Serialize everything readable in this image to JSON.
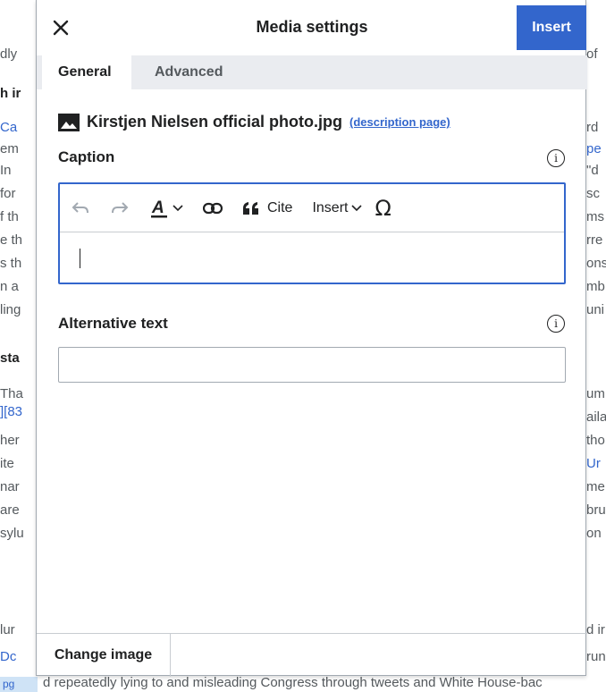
{
  "background": {
    "left": [
      "dly",
      "h ir",
      "Ca",
      "em",
      "In",
      "for",
      "f th",
      "e th",
      "s th",
      "n a",
      "ling",
      "sta",
      "Tha",
      "][83",
      "her",
      "ite",
      "nar",
      "are",
      "sylu",
      "lur",
      "Dc"
    ],
    "right": [
      "of",
      "rd",
      "pe",
      "\"d",
      "sc",
      "ms",
      "rre",
      "ons",
      "mb",
      "uni",
      "um",
      "aila",
      "tho",
      "Ur",
      "me",
      "bru",
      "on",
      "d ir",
      "run"
    ],
    "bottom_text": "d repeatedly lying to and misleading Congress through tweets and White House-bac",
    "bottom_tag": "pg"
  },
  "dialog": {
    "title": "Media settings",
    "insert_label": "Insert",
    "tabs": [
      {
        "label": "General",
        "active": true
      },
      {
        "label": "Advanced",
        "active": false
      }
    ],
    "file": {
      "name": "Kirstjen Nielsen official photo.jpg",
      "desc_link": "(description page)",
      "icon": "image-icon"
    },
    "caption": {
      "label": "Caption",
      "toolbar": {
        "undo_icon": "undo-icon",
        "redo_icon": "redo-icon",
        "style_icon": "text-style-icon",
        "link_icon": "link-icon",
        "cite_label": "Cite",
        "insert_label": "Insert",
        "special_char": "Ω"
      },
      "value": ""
    },
    "alt_text": {
      "label": "Alternative text",
      "value": "",
      "placeholder": ""
    },
    "footer": {
      "change_image_label": "Change image"
    }
  },
  "colors": {
    "accent": "#3366cc",
    "border": "#a2a9b1",
    "tab_bg": "#eaecf0"
  }
}
